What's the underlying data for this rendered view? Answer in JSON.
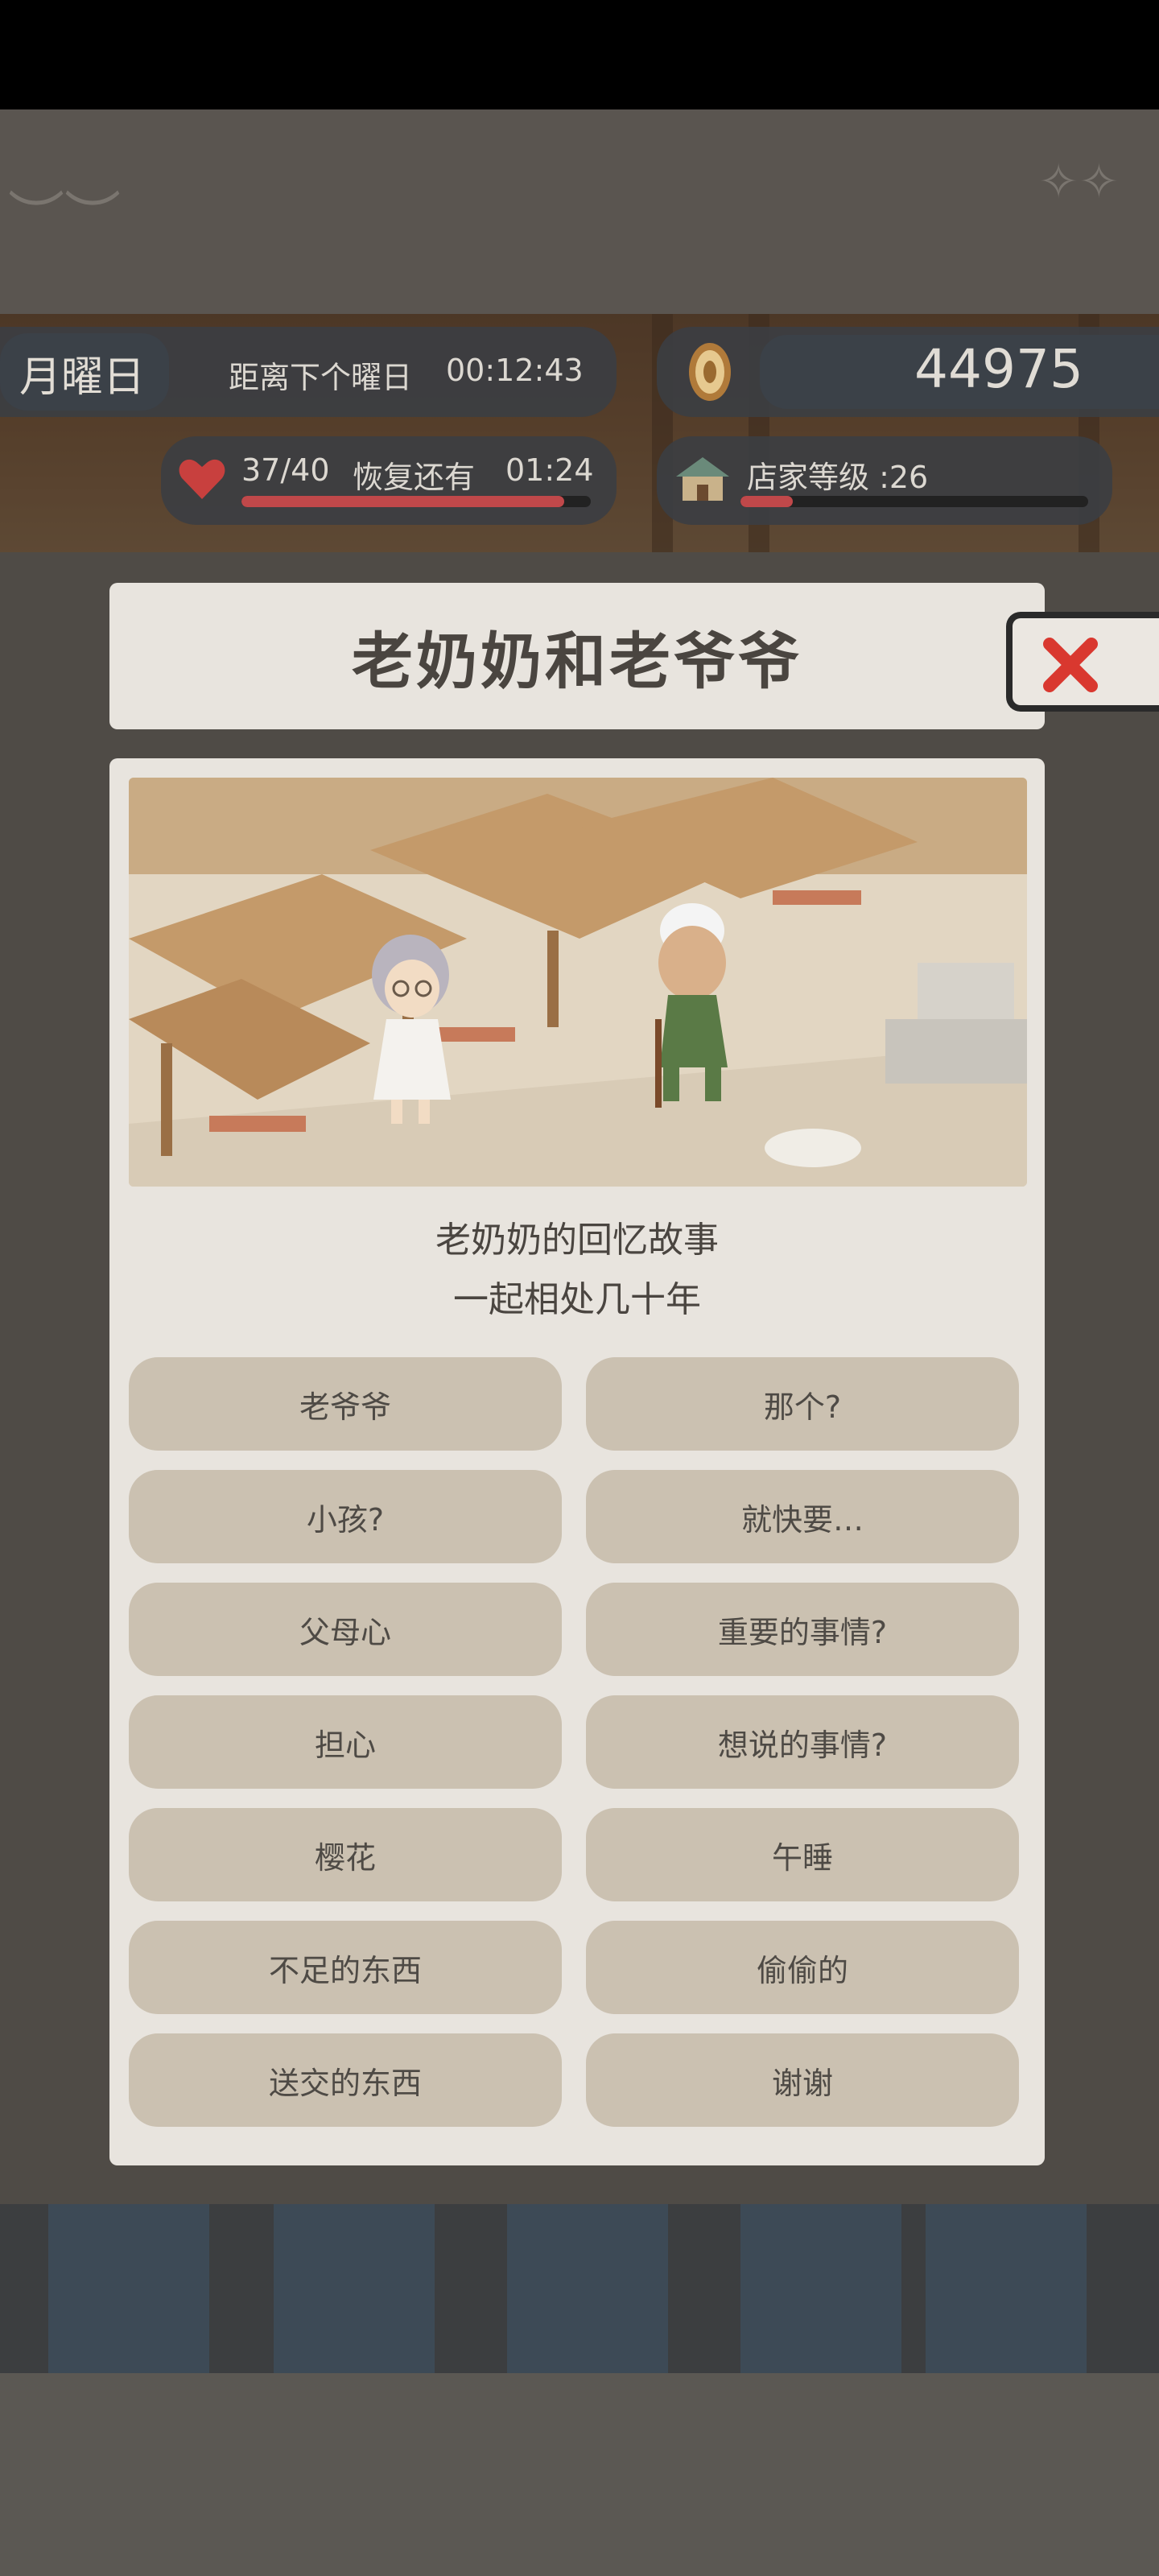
{
  "hud": {
    "weekday": "月曜日",
    "next_day_label": "距离下个曜日",
    "next_day_timer": "00:12:43",
    "coins": "44975",
    "stamina": "37/40",
    "recover_label": "恢复还有",
    "recover_timer": "01:24",
    "stamina_fraction": 0.925,
    "shop_level_label": "店家等级 :26",
    "shop_level_fraction": 0.15
  },
  "dialog": {
    "title": "老奶奶和老爷爷",
    "story_line1": "老奶奶的回忆故事",
    "story_line2": "一起相处几十年",
    "options": [
      "老爷爷",
      "那个?",
      "小孩?",
      "就快要…",
      "父母心",
      "重要的事情?",
      "担心",
      "想说的事情?",
      "樱花",
      "午睡",
      "不足的东西",
      "偷偷的",
      "送交的东西",
      "谢谢"
    ]
  },
  "colors": {
    "health_bar": "#c0484a",
    "close_x": "#d9382f",
    "card_bg": "#e8e4de",
    "option_bg": "#cbc1b1"
  },
  "icons": [
    "heart-icon",
    "coin-icon",
    "shop-icon",
    "close-icon"
  ]
}
